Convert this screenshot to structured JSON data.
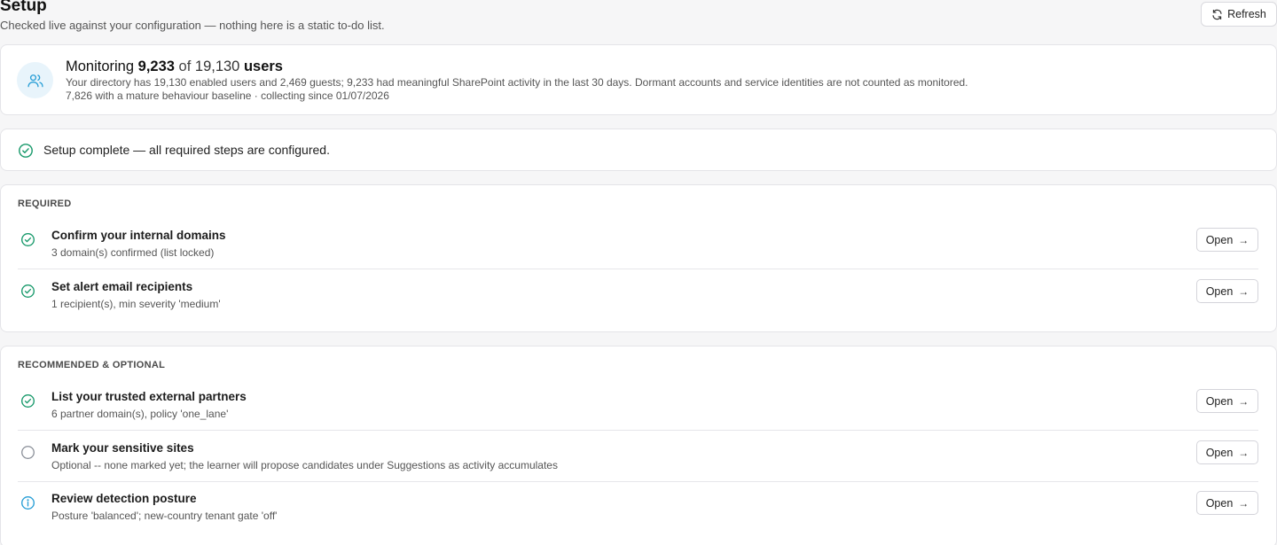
{
  "header": {
    "title": "Setup",
    "subtitle": "Checked live against your configuration — nothing here is a static to-do list.",
    "refresh_label": "Refresh"
  },
  "monitoring": {
    "prefix": "Monitoring",
    "monitored_count": "9,233",
    "of_label": "of",
    "total_count": "19,130",
    "users_label": "users",
    "description": "Your directory has 19,130 enabled users and 2,469 guests; 9,233 had meaningful SharePoint activity in the last 30 days. Dormant accounts and service identities are not counted as monitored.",
    "baseline": "7,826 with a mature behaviour baseline · collecting since 01/07/2026"
  },
  "status": {
    "text": "Setup complete — all required steps are configured.",
    "icon": "check-circle-icon"
  },
  "sections": {
    "required": {
      "label": "REQUIRED",
      "items": [
        {
          "title": "Confirm your internal domains",
          "description": "3 domain(s) confirmed (list locked)",
          "status": "done",
          "button_label": "Open"
        },
        {
          "title": "Set alert email recipients",
          "description": "1 recipient(s), min severity 'medium'",
          "status": "done",
          "button_label": "Open"
        }
      ]
    },
    "optional": {
      "label": "RECOMMENDED & OPTIONAL",
      "items": [
        {
          "title": "List your trusted external partners",
          "description": "6 partner domain(s), policy 'one_lane'",
          "status": "done",
          "button_label": "Open"
        },
        {
          "title": "Mark your sensitive sites",
          "description": "Optional -- none marked yet; the learner will propose candidates under Suggestions as activity accumulates",
          "status": "pending",
          "button_label": "Open"
        },
        {
          "title": "Review detection posture",
          "description": "Posture 'balanced'; new-country tenant gate 'off'",
          "status": "info",
          "button_label": "Open"
        }
      ]
    }
  },
  "colors": {
    "success": "#1a9a6c",
    "info": "#2a9fd6",
    "pending": "#8a8f98",
    "avatar_bg": "#e8f4fb",
    "avatar_icon": "#2a9fd6"
  }
}
